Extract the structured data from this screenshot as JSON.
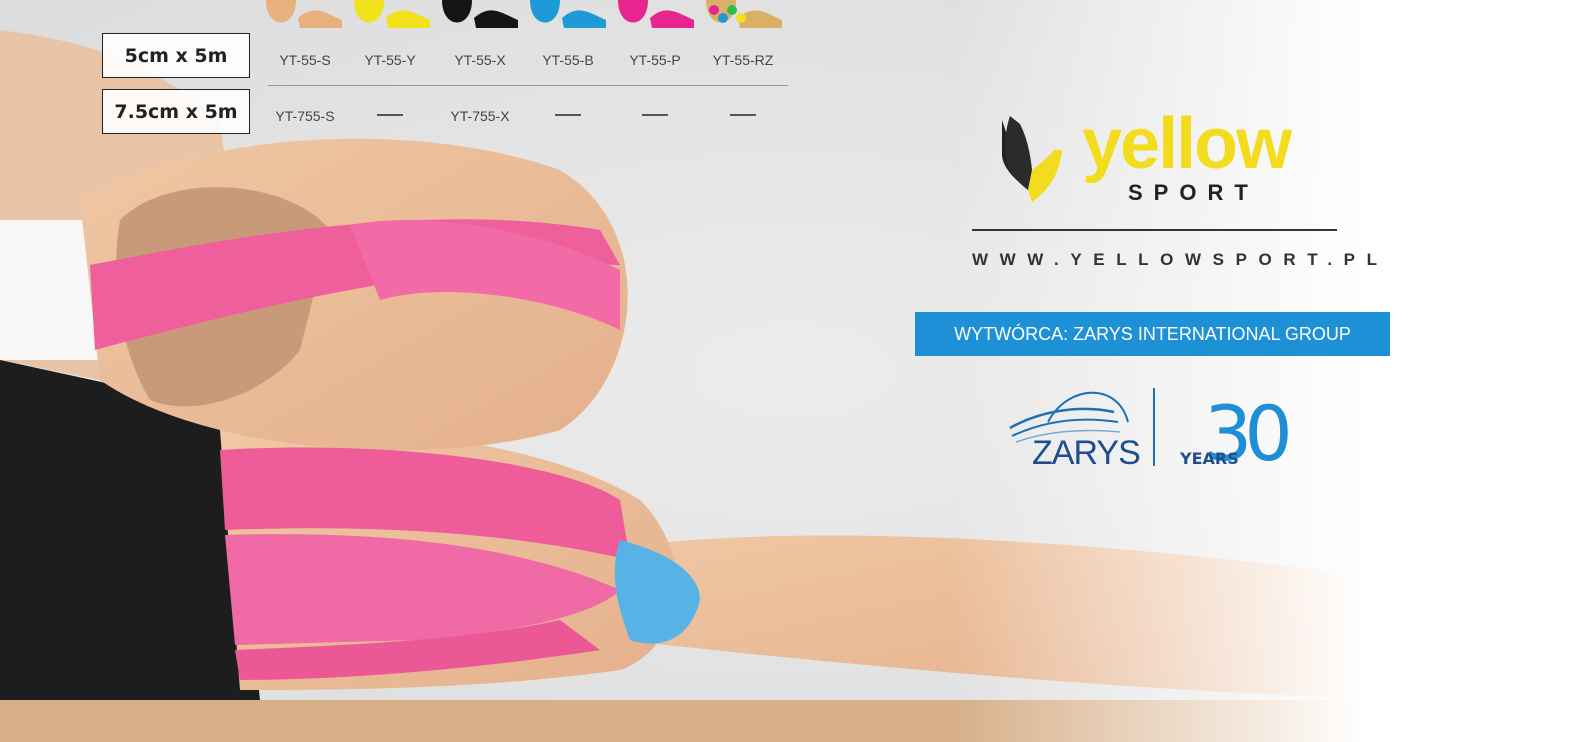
{
  "sizes": [
    {
      "label": "5cm x 5m",
      "codes": [
        "YT-55-S",
        "YT-55-Y",
        "YT-55-X",
        "YT-55-B",
        "YT-55-P",
        "YT-55-RZ"
      ]
    },
    {
      "label": "7.5cm x 5m",
      "codes": [
        "YT-755-S",
        "",
        "YT-755-X",
        "",
        "",
        ""
      ]
    }
  ],
  "tape_colors": [
    "#e8b07f",
    "#f2e21c",
    "#151515",
    "#1e9ad6",
    "#e8258e",
    "#rainbow"
  ],
  "brand": {
    "word": "yellow",
    "sub": "SPORT",
    "accent": "#f2dc1d"
  },
  "website": "WWW.YELLOWSPORT.PL",
  "maker": {
    "label": "WYTWÓRCA: ZARYS INTERNATIONAL GROUP",
    "color": "#1e90d6"
  },
  "partner": {
    "name": "ZARYS",
    "years_number": "30",
    "years_label": "YEARS",
    "color": "#1e6fb5"
  }
}
